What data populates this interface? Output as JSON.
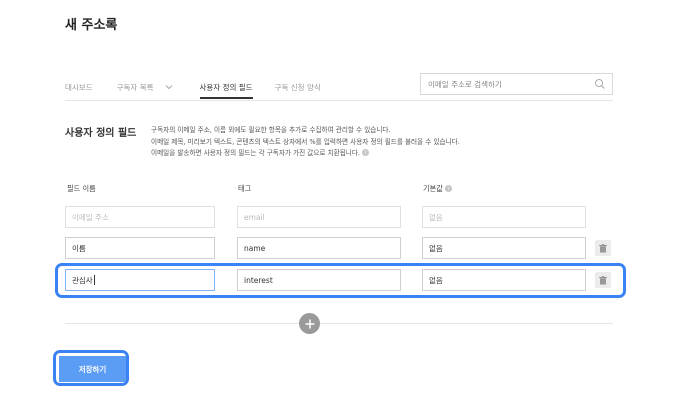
{
  "page": {
    "title": "새 주소록"
  },
  "tabs": {
    "dashboard": "대시보드",
    "subscriber_list": "구독자 목록",
    "custom_fields": "사용자 정의 필드",
    "subscribe_form": "구독 신청 양식"
  },
  "search": {
    "placeholder": "이메일 주소로 검색하기"
  },
  "section": {
    "title": "사용자 정의 필드",
    "desc_line1": "구독자의 이메일 주소, 이름 외에도 필요한 항목을 추가로 수집하여 관리할 수 있습니다.",
    "desc_line2": "이메일 제목, 미리보기 텍스트, 콘텐츠의 텍스트 상자에서 %를 입력하면 사용자 정의 필드를 불러올 수 있습니다.",
    "desc_line3": "이메일을 발송하면 사용자 정의 필드는 각 구독자가 가진 값으로 치환됩니다."
  },
  "columns": {
    "field_name": "필드 이름",
    "tag": "태그",
    "default": "기본값"
  },
  "rows": [
    {
      "name": "",
      "name_placeholder": "이메일 주소",
      "tag": "",
      "tag_placeholder": "email",
      "default": "",
      "default_placeholder": "없음"
    },
    {
      "name": "이름",
      "tag": "name",
      "default": "없음"
    },
    {
      "name": "관심사",
      "tag": "interest",
      "default": "없음"
    }
  ],
  "buttons": {
    "save": "저장하기"
  },
  "colors": {
    "accent": "#5b9cf5",
    "highlight": "#3b82f6"
  }
}
